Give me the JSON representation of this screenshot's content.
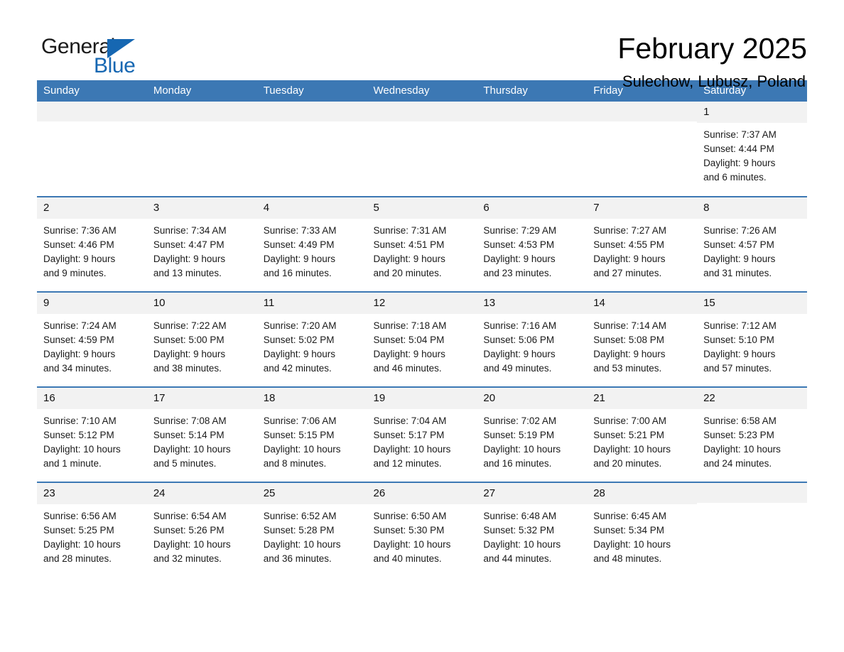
{
  "brand": {
    "word_one": "General",
    "word_two": "Blue",
    "flag_icon": "triangle-flag-icon",
    "accent_color": "#1667b2"
  },
  "header": {
    "month_title": "February 2025",
    "location": "Sulechow, Lubusz, Poland"
  },
  "calendar": {
    "header_background": "#3c78b4",
    "daynum_background": "#f2f2f2",
    "weekday_headers": [
      "Sunday",
      "Monday",
      "Tuesday",
      "Wednesday",
      "Thursday",
      "Friday",
      "Saturday"
    ],
    "weeks": [
      [
        {
          "day": "",
          "info": "",
          "blank": true
        },
        {
          "day": "",
          "info": "",
          "blank": true
        },
        {
          "day": "",
          "info": "",
          "blank": true
        },
        {
          "day": "",
          "info": "",
          "blank": true
        },
        {
          "day": "",
          "info": "",
          "blank": true
        },
        {
          "day": "",
          "info": "",
          "blank": true
        },
        {
          "day": "1",
          "info": "Sunrise: 7:37 AM\nSunset: 4:44 PM\nDaylight: 9 hours\nand 6 minutes.",
          "blank": false
        }
      ],
      [
        {
          "day": "2",
          "info": "Sunrise: 7:36 AM\nSunset: 4:46 PM\nDaylight: 9 hours\nand 9 minutes.",
          "blank": false
        },
        {
          "day": "3",
          "info": "Sunrise: 7:34 AM\nSunset: 4:47 PM\nDaylight: 9 hours\nand 13 minutes.",
          "blank": false
        },
        {
          "day": "4",
          "info": "Sunrise: 7:33 AM\nSunset: 4:49 PM\nDaylight: 9 hours\nand 16 minutes.",
          "blank": false
        },
        {
          "day": "5",
          "info": "Sunrise: 7:31 AM\nSunset: 4:51 PM\nDaylight: 9 hours\nand 20 minutes.",
          "blank": false
        },
        {
          "day": "6",
          "info": "Sunrise: 7:29 AM\nSunset: 4:53 PM\nDaylight: 9 hours\nand 23 minutes.",
          "blank": false
        },
        {
          "day": "7",
          "info": "Sunrise: 7:27 AM\nSunset: 4:55 PM\nDaylight: 9 hours\nand 27 minutes.",
          "blank": false
        },
        {
          "day": "8",
          "info": "Sunrise: 7:26 AM\nSunset: 4:57 PM\nDaylight: 9 hours\nand 31 minutes.",
          "blank": false
        }
      ],
      [
        {
          "day": "9",
          "info": "Sunrise: 7:24 AM\nSunset: 4:59 PM\nDaylight: 9 hours\nand 34 minutes.",
          "blank": false
        },
        {
          "day": "10",
          "info": "Sunrise: 7:22 AM\nSunset: 5:00 PM\nDaylight: 9 hours\nand 38 minutes.",
          "blank": false
        },
        {
          "day": "11",
          "info": "Sunrise: 7:20 AM\nSunset: 5:02 PM\nDaylight: 9 hours\nand 42 minutes.",
          "blank": false
        },
        {
          "day": "12",
          "info": "Sunrise: 7:18 AM\nSunset: 5:04 PM\nDaylight: 9 hours\nand 46 minutes.",
          "blank": false
        },
        {
          "day": "13",
          "info": "Sunrise: 7:16 AM\nSunset: 5:06 PM\nDaylight: 9 hours\nand 49 minutes.",
          "blank": false
        },
        {
          "day": "14",
          "info": "Sunrise: 7:14 AM\nSunset: 5:08 PM\nDaylight: 9 hours\nand 53 minutes.",
          "blank": false
        },
        {
          "day": "15",
          "info": "Sunrise: 7:12 AM\nSunset: 5:10 PM\nDaylight: 9 hours\nand 57 minutes.",
          "blank": false
        }
      ],
      [
        {
          "day": "16",
          "info": "Sunrise: 7:10 AM\nSunset: 5:12 PM\nDaylight: 10 hours\nand 1 minute.",
          "blank": false
        },
        {
          "day": "17",
          "info": "Sunrise: 7:08 AM\nSunset: 5:14 PM\nDaylight: 10 hours\nand 5 minutes.",
          "blank": false
        },
        {
          "day": "18",
          "info": "Sunrise: 7:06 AM\nSunset: 5:15 PM\nDaylight: 10 hours\nand 8 minutes.",
          "blank": false
        },
        {
          "day": "19",
          "info": "Sunrise: 7:04 AM\nSunset: 5:17 PM\nDaylight: 10 hours\nand 12 minutes.",
          "blank": false
        },
        {
          "day": "20",
          "info": "Sunrise: 7:02 AM\nSunset: 5:19 PM\nDaylight: 10 hours\nand 16 minutes.",
          "blank": false
        },
        {
          "day": "21",
          "info": "Sunrise: 7:00 AM\nSunset: 5:21 PM\nDaylight: 10 hours\nand 20 minutes.",
          "blank": false
        },
        {
          "day": "22",
          "info": "Sunrise: 6:58 AM\nSunset: 5:23 PM\nDaylight: 10 hours\nand 24 minutes.",
          "blank": false
        }
      ],
      [
        {
          "day": "23",
          "info": "Sunrise: 6:56 AM\nSunset: 5:25 PM\nDaylight: 10 hours\nand 28 minutes.",
          "blank": false
        },
        {
          "day": "24",
          "info": "Sunrise: 6:54 AM\nSunset: 5:26 PM\nDaylight: 10 hours\nand 32 minutes.",
          "blank": false
        },
        {
          "day": "25",
          "info": "Sunrise: 6:52 AM\nSunset: 5:28 PM\nDaylight: 10 hours\nand 36 minutes.",
          "blank": false
        },
        {
          "day": "26",
          "info": "Sunrise: 6:50 AM\nSunset: 5:30 PM\nDaylight: 10 hours\nand 40 minutes.",
          "blank": false
        },
        {
          "day": "27",
          "info": "Sunrise: 6:48 AM\nSunset: 5:32 PM\nDaylight: 10 hours\nand 44 minutes.",
          "blank": false
        },
        {
          "day": "28",
          "info": "Sunrise: 6:45 AM\nSunset: 5:34 PM\nDaylight: 10 hours\nand 48 minutes.",
          "blank": false
        },
        {
          "day": "",
          "info": "",
          "blank": true
        }
      ]
    ]
  }
}
